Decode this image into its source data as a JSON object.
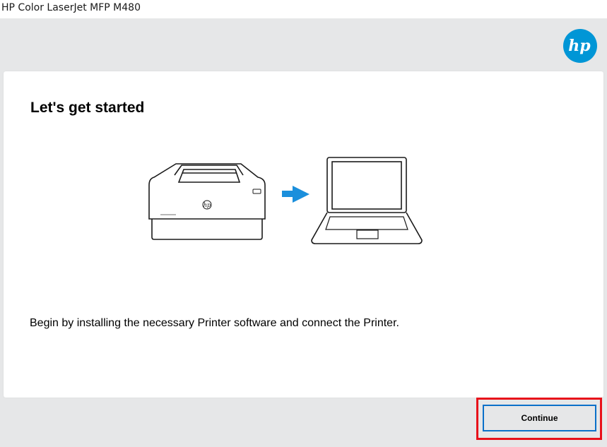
{
  "window": {
    "title": "HP Color LaserJet MFP M480"
  },
  "brand": {
    "logo_icon": "hp-logo-icon",
    "logo_text": "hp",
    "accent_color": "#0096d6"
  },
  "main": {
    "title": "Let's get started",
    "description": "Begin by installing the necessary Printer software and connect the Printer.",
    "illustration": {
      "icons": [
        "printer-icon",
        "arrow-right-icon",
        "laptop-icon"
      ],
      "printer_logo_text": "hp"
    }
  },
  "footer": {
    "continue_label": "Continue",
    "button_border_color": "#0b70c9",
    "highlight_color": "#e8101a"
  }
}
